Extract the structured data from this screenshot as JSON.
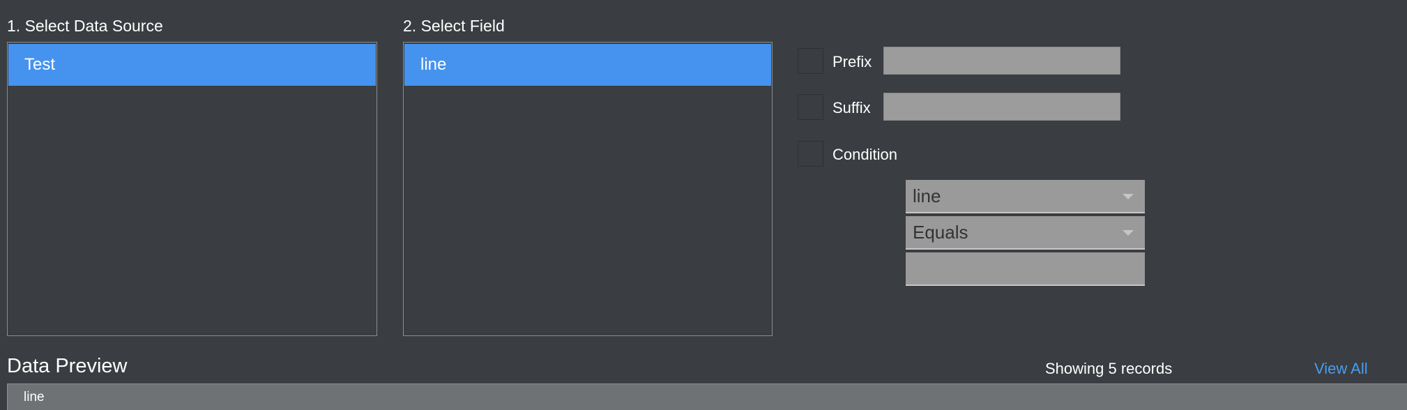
{
  "data_source": {
    "label": "1. Select Data Source",
    "items": [
      {
        "label": "Test",
        "selected": true
      }
    ]
  },
  "field": {
    "label": "2. Select Field",
    "items": [
      {
        "label": "line",
        "selected": true
      }
    ]
  },
  "options": {
    "prefix": {
      "label": "Prefix",
      "checked": false,
      "value": ""
    },
    "suffix": {
      "label": "Suffix",
      "checked": false,
      "value": ""
    },
    "condition": {
      "label": "Condition",
      "checked": false,
      "field_select": "line",
      "operator_select": "Equals",
      "value": ""
    }
  },
  "preview": {
    "title": "Data Preview",
    "count_text": "Showing 5 records",
    "view_all": "View All",
    "columns": [
      "line"
    ]
  },
  "colors": {
    "background": "#3a3d41",
    "accent": "#4593ee",
    "link": "#4a9df0",
    "input": "#9c9c9c"
  }
}
